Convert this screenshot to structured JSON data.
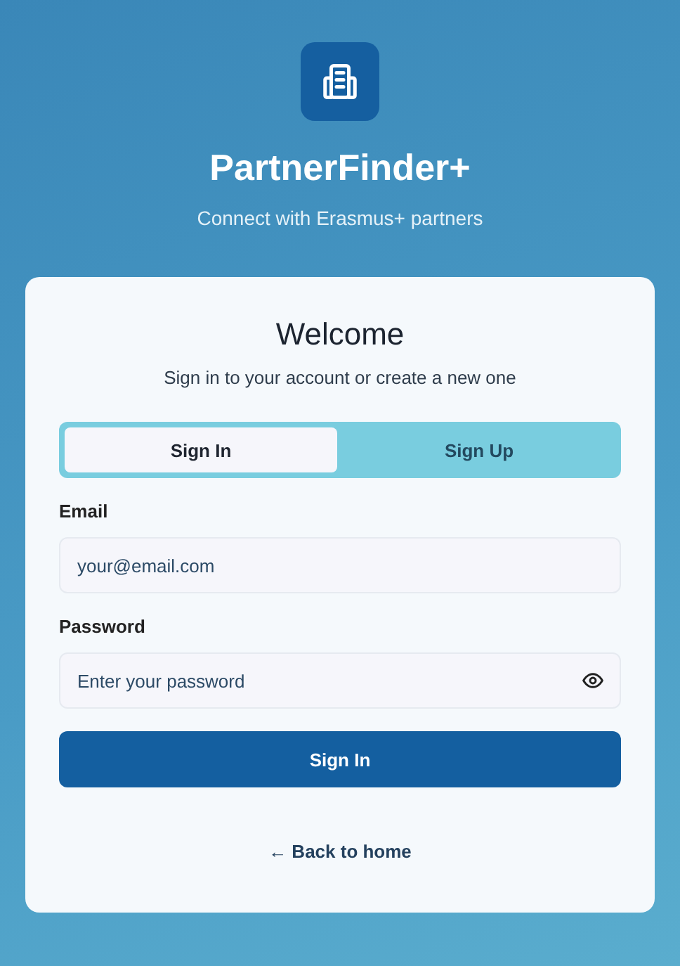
{
  "app": {
    "title": "PartnerFinder+",
    "subtitle": "Connect with Erasmus+ partners"
  },
  "card": {
    "title": "Welcome",
    "subtitle": "Sign in to your account or create a new one"
  },
  "tabs": [
    {
      "label": "Sign In",
      "selected": true
    },
    {
      "label": "Sign Up",
      "selected": false
    }
  ],
  "fields": [
    {
      "label": "Email",
      "placeholder": "your@email.com",
      "kind": "email"
    },
    {
      "label": "Password",
      "placeholder": "Enter your password",
      "kind": "password"
    }
  ],
  "submit": "Sign In",
  "back_link": "← Back to home"
}
